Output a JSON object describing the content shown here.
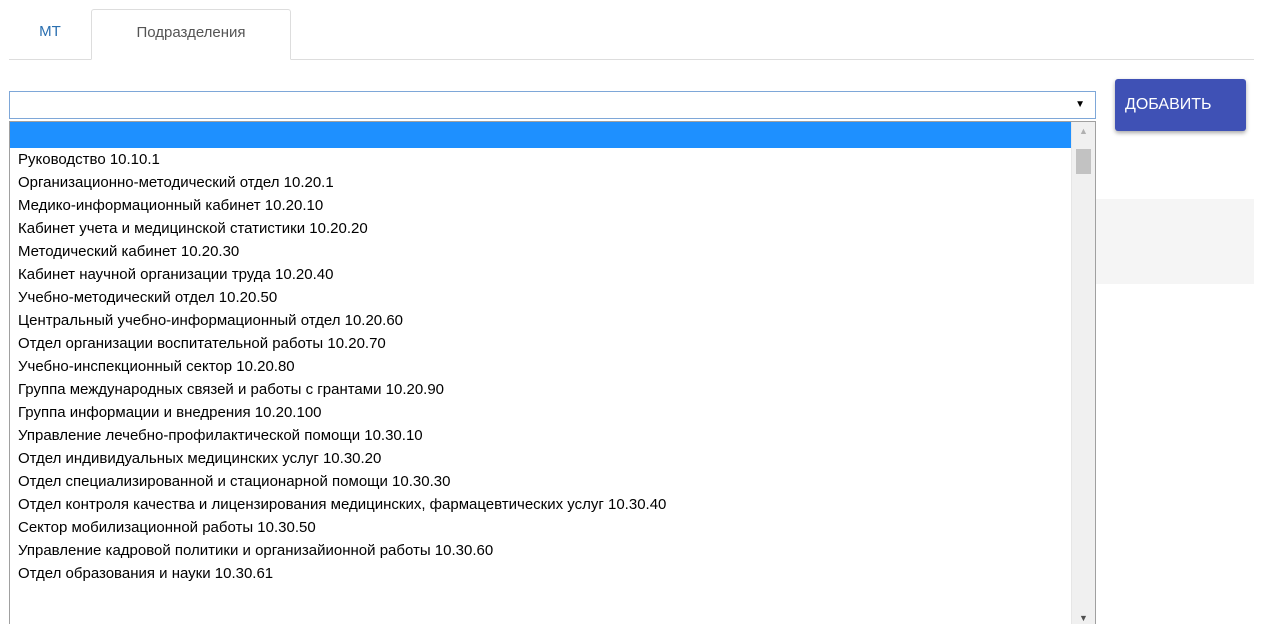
{
  "tabs": [
    {
      "label": "МТ"
    },
    {
      "label": "Подразделения"
    }
  ],
  "select": {
    "value": "",
    "arrow_icon": "triangle-down-icon"
  },
  "add_button": {
    "label": "ДОБАВИТЬ"
  },
  "dropdown": {
    "options": [
      {
        "label": ""
      },
      {
        "label": "Руководство 10.10.1"
      },
      {
        "label": "Организационно-методический отдел 10.20.1"
      },
      {
        "label": "Медико-информационный кабинет 10.20.10"
      },
      {
        "label": "Кабинет учета и медицинской статистики 10.20.20"
      },
      {
        "label": "Методический кабинет 10.20.30"
      },
      {
        "label": "Кабинет научной организации труда 10.20.40"
      },
      {
        "label": "Учебно-методический отдел 10.20.50"
      },
      {
        "label": "Центральный учебно-информационный отдел 10.20.60"
      },
      {
        "label": "Отдел организации воспитательной работы 10.20.70"
      },
      {
        "label": "Учебно-инспекционный сектор 10.20.80"
      },
      {
        "label": "Группа международных связей и работы с грантами 10.20.90"
      },
      {
        "label": "Группа информации и внедрения 10.20.100"
      },
      {
        "label": "Управление лечебно-профилактической помощи 10.30.10"
      },
      {
        "label": "Отдел индивидуальных медицинских услуг 10.30.20"
      },
      {
        "label": "Отдел специализированной и стационарной помощи 10.30.30"
      },
      {
        "label": "Отдел контроля качества и лицензирования медицинских, фармацевтических услуг 10.30.40"
      },
      {
        "label": "Сектор мобилизационной работы 10.30.50"
      },
      {
        "label": "Управление кадровой политики и организайионной работы 10.30.60"
      },
      {
        "label": "Отдел образования и науки 10.30.61"
      }
    ],
    "selected_index": 0
  },
  "colors": {
    "accent": "#3f51b5",
    "highlight": "#1e90ff",
    "tab_link": "#2a6fb0"
  }
}
